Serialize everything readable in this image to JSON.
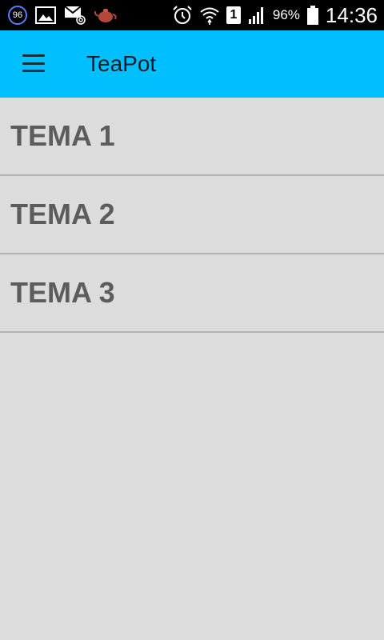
{
  "status_bar": {
    "notification_badge": "96",
    "battery_percent": "96%",
    "sim_slot": "1",
    "time": "14:36",
    "icons": [
      "badge-96-icon",
      "image-icon",
      "email-at-icon",
      "teapot-icon",
      "alarm-icon",
      "wifi-icon",
      "sim-icon",
      "signal-icon",
      "battery-icon"
    ]
  },
  "app_bar": {
    "title": "TeaPot",
    "background": "#00bfff",
    "menu_icon": "hamburger-menu-icon"
  },
  "topics": [
    {
      "label": "TEMA 1"
    },
    {
      "label": "TEMA 2"
    },
    {
      "label": "TEMA 3"
    }
  ]
}
